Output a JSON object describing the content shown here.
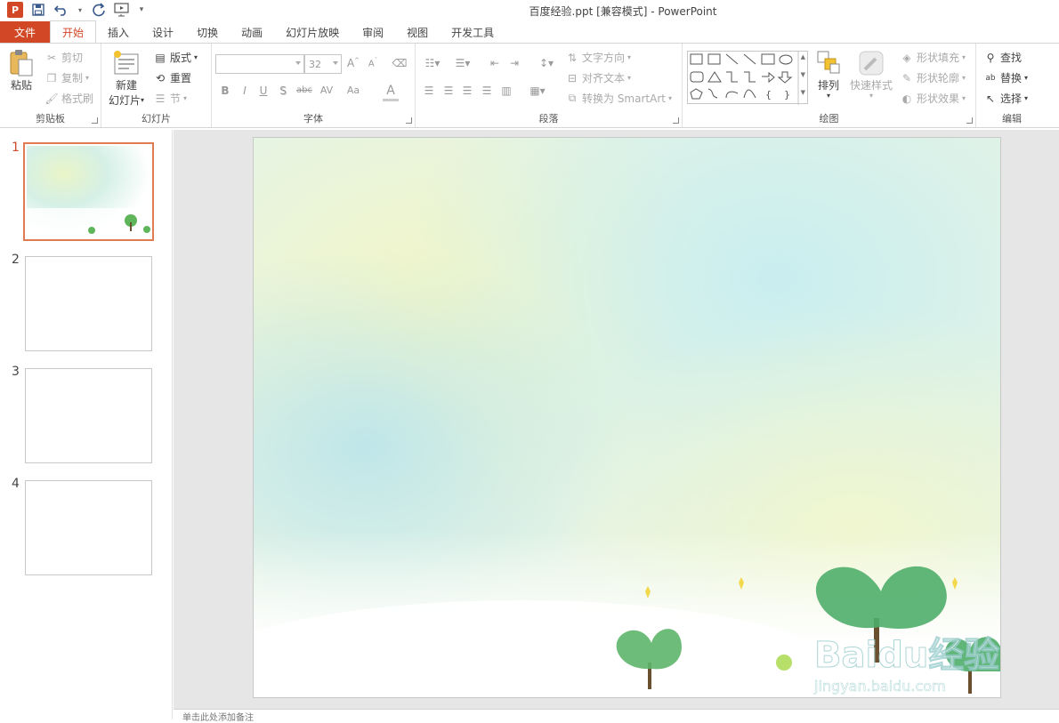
{
  "window": {
    "title": "百度经验.ppt [兼容模式] - PowerPoint"
  },
  "qat": {
    "app_icon_letter": "P",
    "items": [
      "save-icon",
      "undo-icon",
      "redo-icon",
      "present-icon",
      "customize-icon"
    ]
  },
  "tabs": [
    {
      "label": "文件"
    },
    {
      "label": "开始"
    },
    {
      "label": "插入"
    },
    {
      "label": "设计"
    },
    {
      "label": "切换"
    },
    {
      "label": "动画"
    },
    {
      "label": "幻灯片放映"
    },
    {
      "label": "审阅"
    },
    {
      "label": "视图"
    },
    {
      "label": "开发工具"
    }
  ],
  "ribbon": {
    "clipboard": {
      "label": "剪贴板",
      "paste": "粘贴",
      "cut": "剪切",
      "copy": "复制",
      "format_painter": "格式刷"
    },
    "slides": {
      "label": "幻灯片",
      "new_slide_line1": "新建",
      "new_slide_line2": "幻灯片",
      "layout": "版式",
      "reset": "重置",
      "section": "节"
    },
    "font": {
      "label": "字体",
      "font_name": "",
      "font_size": "32",
      "bold": "B",
      "italic": "I",
      "underline": "U",
      "shadow": "S",
      "strike": "abc",
      "spacing": "AV",
      "case": "Aa",
      "color": "A"
    },
    "paragraph": {
      "label": "段落",
      "text_direction": "文字方向",
      "align_text": "对齐文本",
      "smartart": "转换为 SmartArt"
    },
    "drawing": {
      "label": "绘图",
      "arrange": "排列",
      "quick_styles": "快速样式",
      "shape_fill": "形状填充",
      "shape_outline": "形状轮廓",
      "shape_effects": "形状效果"
    },
    "editing": {
      "label": "编辑",
      "find": "查找",
      "replace": "替换",
      "select": "选择"
    }
  },
  "slides_panel": {
    "thumbs": [
      {
        "num": "1",
        "selected": true
      },
      {
        "num": "2",
        "selected": false
      },
      {
        "num": "3",
        "selected": false
      },
      {
        "num": "4",
        "selected": false
      }
    ]
  },
  "slide": {
    "watermark_brand": "Baidu经验",
    "watermark_url": "jingyan.baidu.com"
  },
  "notes": {
    "placeholder": "单击此处添加备注"
  },
  "colors": {
    "accent": "#d24726",
    "thumb_selected": "#e07b53"
  }
}
